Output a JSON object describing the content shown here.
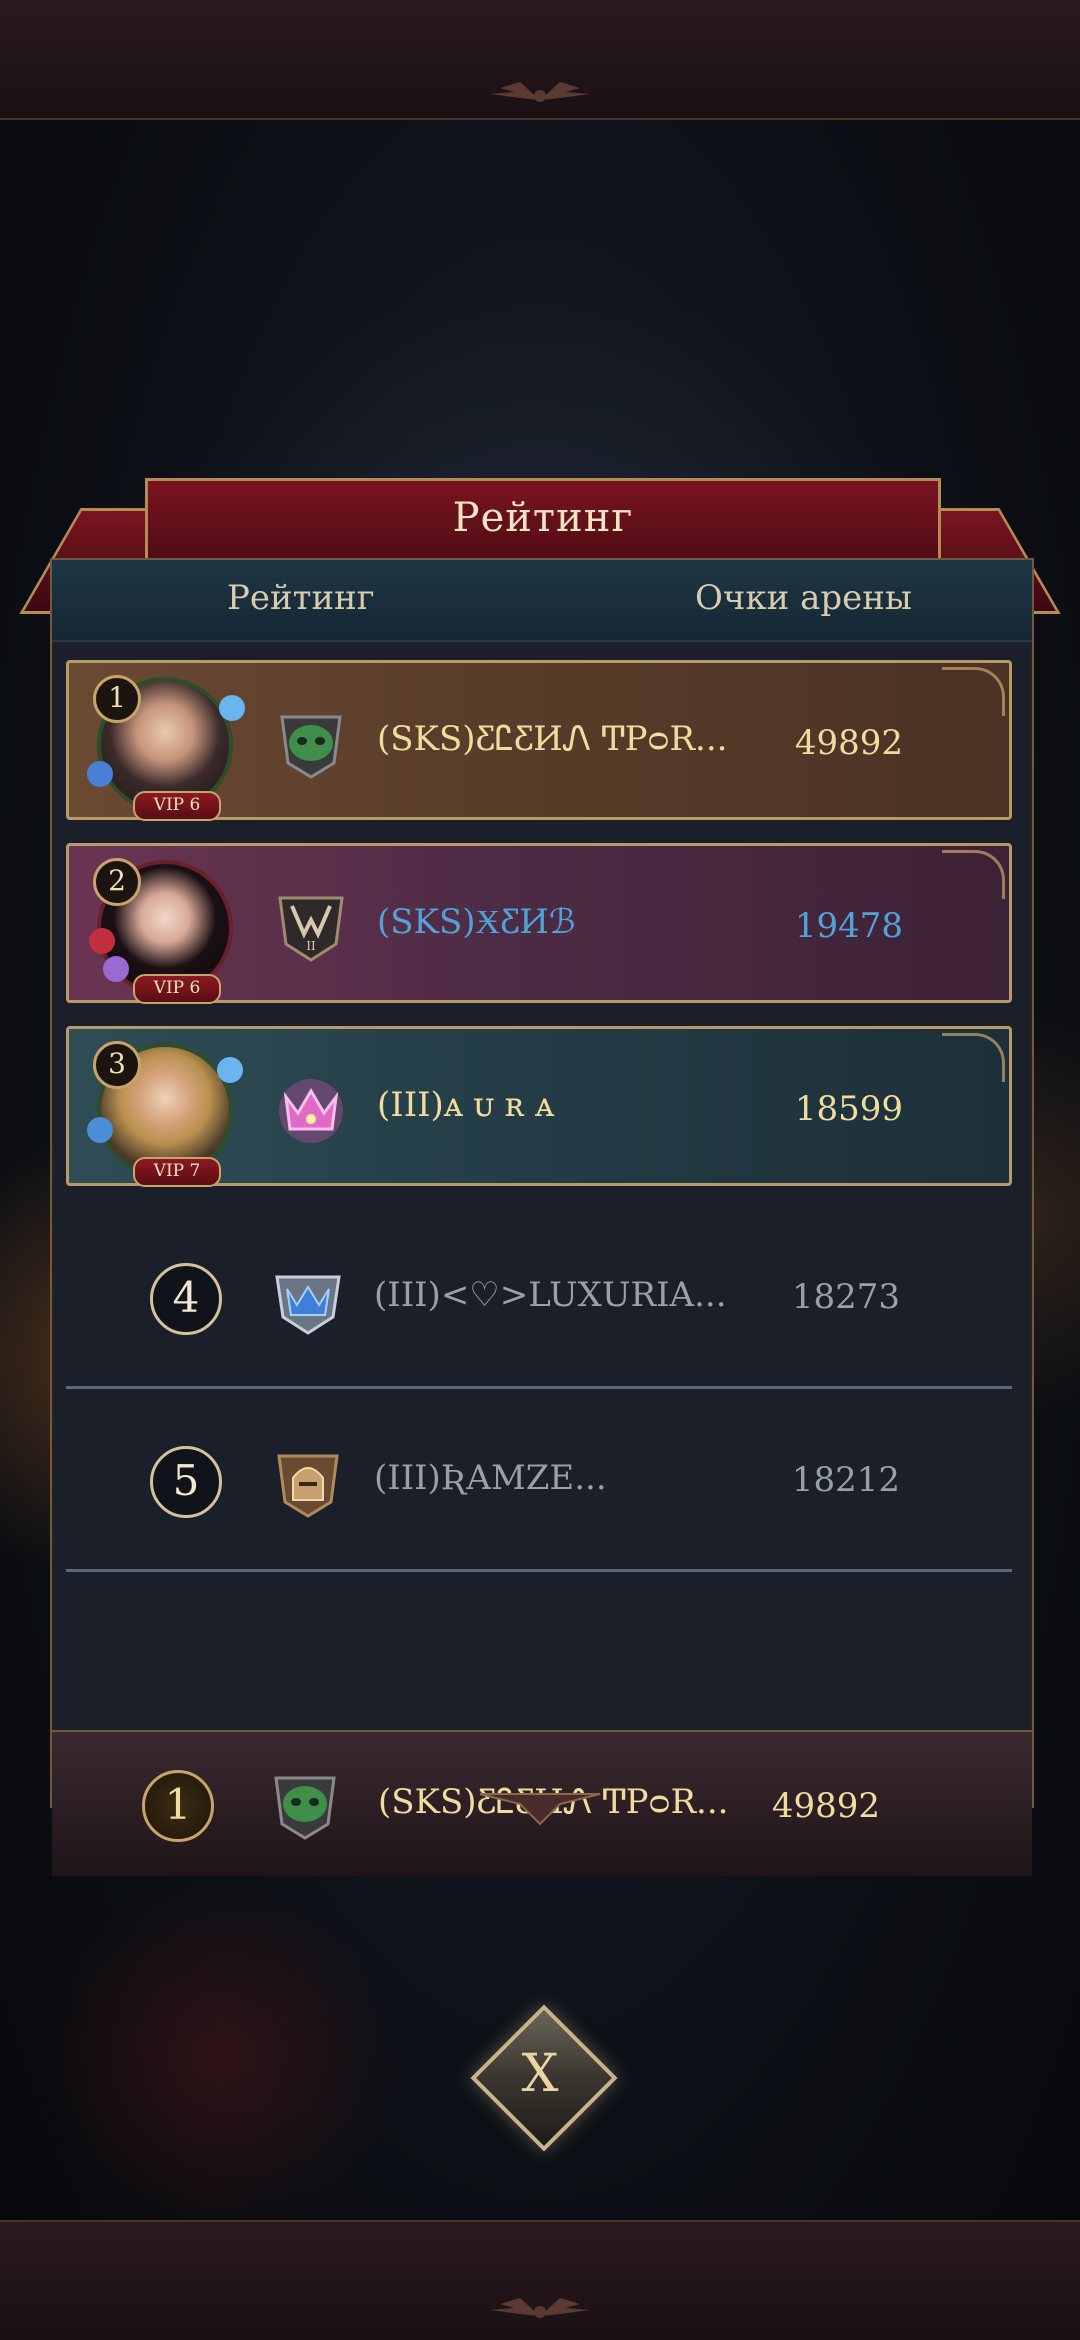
{
  "dialog": {
    "title": "Рейтинг",
    "header": {
      "col_rank": "Рейтинг",
      "col_points": "Очки арены"
    }
  },
  "rows": [
    {
      "rank": "1",
      "vip": "VIP 6",
      "name": "(SKS)ƸᏝƸИᏁ ͲРᴑR...",
      "score": "49892",
      "emblem": "green-mask-emblem-icon"
    },
    {
      "rank": "2",
      "vip": "VIP 6",
      "name": "(SKS)ӾƸИℬ",
      "score": "19478",
      "emblem": "winged-shield-emblem-icon"
    },
    {
      "rank": "3",
      "vip": "VIP 7",
      "name": "(III)ᴀ ᴜ ʀ ᴀ",
      "score": "18599",
      "emblem": "pink-crown-emblem-icon"
    },
    {
      "rank": "4",
      "name": "(III)<♡>LUXURIA...",
      "score": "18273",
      "emblem": "blue-crown-emblem-icon"
    },
    {
      "rank": "5",
      "name": "(III)ƦAMZE...",
      "score": "18212",
      "emblem": "helmet-emblem-icon"
    }
  ],
  "self": {
    "rank": "1",
    "name": "(SKS)ƸᏝƸИᏁ ͲРᴑR...",
    "score": "49892",
    "emblem": "green-mask-emblem-icon"
  },
  "close_label": "X",
  "colors": {
    "gold_text": "#f1dca0",
    "blue_text": "#4fa3d8",
    "grey_text": "#9aa0aa",
    "frame_gold": "#b89968"
  }
}
